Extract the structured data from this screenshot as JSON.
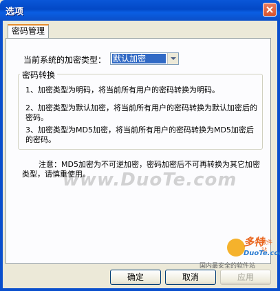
{
  "window": {
    "title": "选项"
  },
  "tabs": [
    {
      "label": "密码管理",
      "active": true
    }
  ],
  "encryption": {
    "label": "当前系统的加密类型：",
    "selected": "默认加密"
  },
  "conversion": {
    "legend": "密码转换",
    "items": [
      "1、加密类型为明码，将当前所有用户的密码转换为明码。",
      "2、加密类型为默认加密，将当前所有用户的密码转换为默认加密后的密码。",
      "3、加密类型为MD5加密，将当前所有用户的密码转换为MD5加密后的密码。"
    ]
  },
  "note": "注意：MD5加密为不可逆加密，密码加密后不可再转换为其它加密类型，请慎重使用。",
  "watermark": "www.DuoTe.com",
  "buttons": {
    "ok": "确定",
    "cancel": "取消",
    "apply": "应用"
  },
  "logo": {
    "brand": "多特",
    "sub": "软件站",
    "domain": "DuoTe.com",
    "slogan": "国内最安全的软件站"
  },
  "colors": {
    "titlebar": "#0a57d8",
    "selection": "#316ac5",
    "tab_accent": "#e68b2c"
  }
}
